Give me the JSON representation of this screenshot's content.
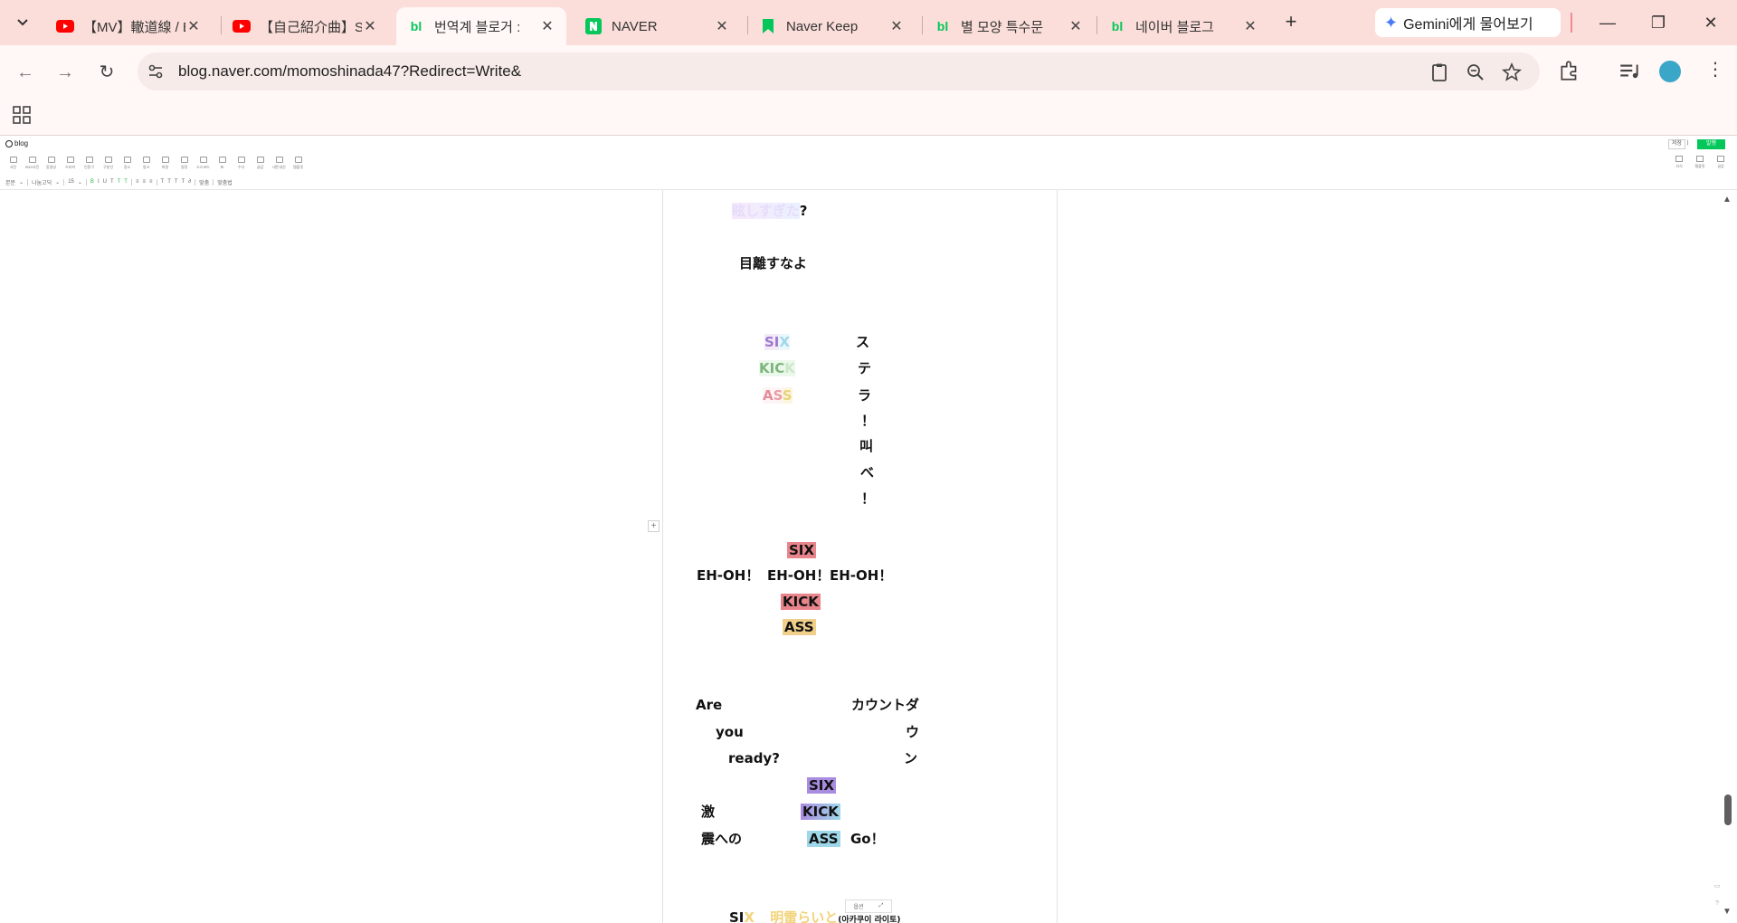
{
  "tabs": [
    {
      "title": "【MV】轍道線 / E",
      "favicon": "youtube-icon",
      "active": false
    },
    {
      "title": "【自己紹介曲】SI",
      "favicon": "youtube-icon",
      "active": false
    },
    {
      "title": "번역계 블로거 :",
      "favicon": "naver-blog-icon",
      "active": true
    },
    {
      "title": "NAVER",
      "favicon": "naver-icon",
      "active": false
    },
    {
      "title": "Naver Keep",
      "favicon": "naver-keep-icon",
      "active": false
    },
    {
      "title": "별 모양 특수문",
      "favicon": "naver-blog-icon",
      "active": false
    },
    {
      "title": "네이버 블로그",
      "favicon": "naver-blog-icon",
      "active": false
    }
  ],
  "gemini_label": "Gemini에게 물어보기",
  "address": {
    "url": "blog.naver.com/momoshinada47?Redirect=Write&"
  },
  "editor": {
    "logo": "blog",
    "header_buttons": [
      "저장",
      "|",
      "발행"
    ],
    "insert_toolbar": [
      "사진",
      "SNS사진",
      "동영상",
      "스티커",
      "인용구",
      "구분선",
      "장소",
      "링크",
      "파일",
      "일정",
      "소스코드",
      "표",
      "수식",
      "글감",
      "내돈내산",
      "템플릿"
    ],
    "insert_toolbar_right": [
      "서식",
      "템플릿",
      "글감"
    ],
    "format_toolbar": {
      "style": "본문",
      "font": "나눔고딕",
      "size": "15",
      "items": [
        "B",
        "I",
        "U",
        "T",
        "T",
        "T",
        "≡",
        "≡",
        "≡",
        "T",
        "T",
        "T",
        "T",
        "∂",
        "맞춤",
        "맞춤법"
      ]
    },
    "colors": {
      "accent": "#03c75a",
      "tab_strip": "#fbded9",
      "toolbar": "#fff8f6"
    }
  },
  "content": {
    "l01a": "眩しすぎた",
    "l01b": "?",
    "l02": "目離すなよ",
    "l03a_1": "SI",
    "l03a_2": "X",
    "l03b": "ス",
    "l04a_1": "KIC",
    "l04a_2": "K",
    "l04b": "テ",
    "l05a_1": "A",
    "l05a_2": "S",
    "l05a_3": "S",
    "l05b": "ラ",
    "l06": "！",
    "l07": "叫",
    "l08": "べ",
    "l09": "！",
    "l10": "SIX",
    "l11a": "EH-OH！",
    "l11b": "EH-OH！",
    "l11c": "EH-OH！",
    "l12": "KICK",
    "l13": "ASS",
    "l14a": "Are",
    "l14b": "カウントダ",
    "l15a": "you",
    "l15b": "ウ",
    "l16a": "ready?",
    "l16b": "ン",
    "l17": "SIX",
    "l18a": "激",
    "l18b": "KICK",
    "l19a": "震への",
    "l19b": "ASS",
    "l19c": "Go！",
    "l20a_1": "SI",
    "l20a_2": "X",
    "l20b": "明雷らいと",
    "l20c": "(아카쿠이 라이토)"
  },
  "image_toolbar": [
    "옵션",
    "⤢"
  ]
}
